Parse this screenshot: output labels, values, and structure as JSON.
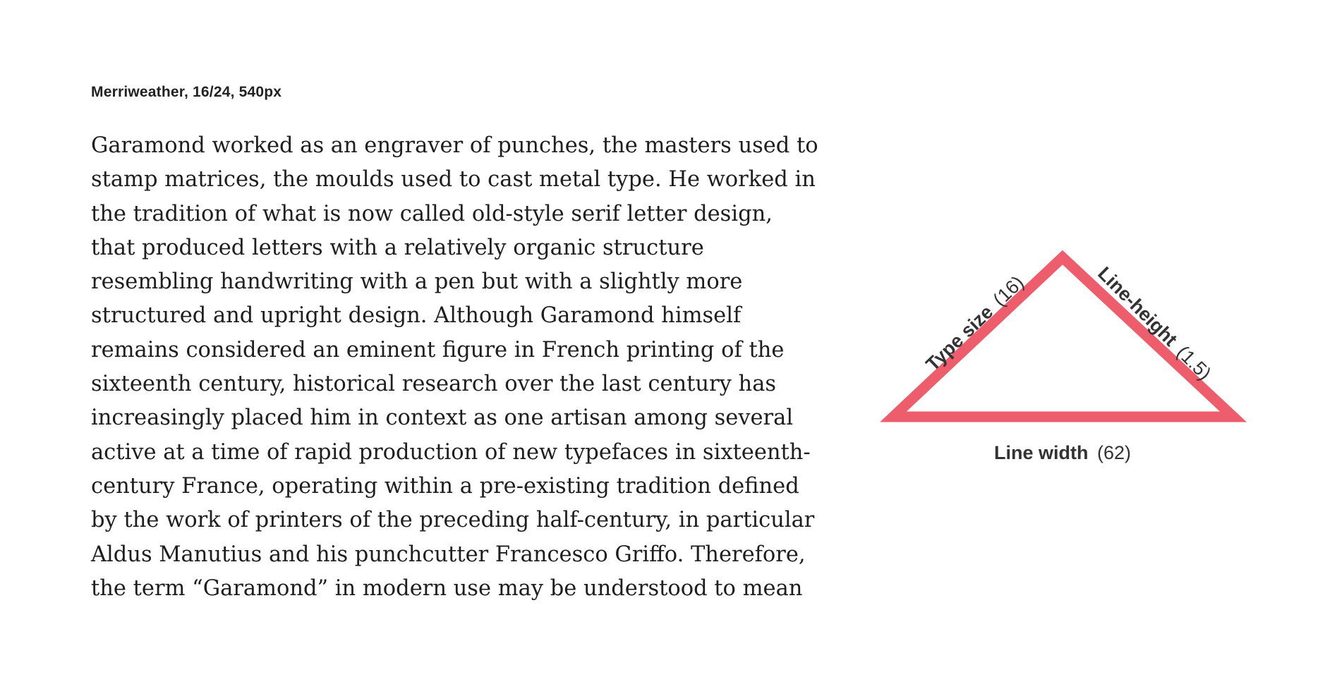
{
  "spec_label": "Merriweather, 16/24, 540px",
  "sample_lines": [
    "Garamond worked as an engraver of punches, the masters used to",
    "stamp matrices, the moulds used to cast metal type. He worked in",
    "the tradition of what is now called old-style serif letter design,",
    "that produced letters with a relatively organic structure",
    "resembling handwriting with a pen but with a slightly more",
    "structured and upright design. Although Garamond himself",
    "remains considered an eminent figure in French printing of the",
    "sixteenth century, historical research over the last century has",
    "increasingly placed him in context as one artisan among several",
    "active at a time of rapid production of new typefaces in sixteenth-",
    "century France, operating within a pre-existing tradition defined",
    "by the work of printers of the preceding half-century, in particular",
    "Aldus Manutius and his punchcutter Francesco Griffo. Therefore,",
    "the term “Garamond” in modern use may be understood to mean"
  ],
  "diagram": {
    "triangle_color": "#ee5d6b",
    "left_side": {
      "label": "Type size",
      "value": "(16)"
    },
    "right_side": {
      "label": "Line-height",
      "value": "(1.5)"
    },
    "base": {
      "label": "Line width",
      "value": "(62)"
    }
  }
}
